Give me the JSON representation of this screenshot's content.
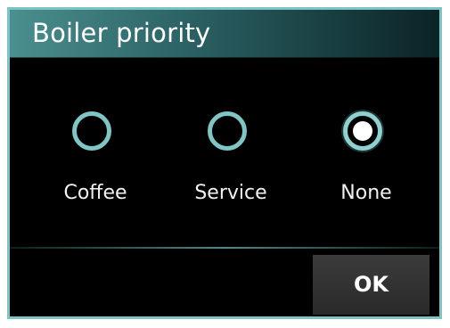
{
  "dialog": {
    "title": "Boiler priority"
  },
  "options": [
    {
      "label": "Coffee",
      "selected": false
    },
    {
      "label": "Service",
      "selected": false
    },
    {
      "label": "None",
      "selected": true
    }
  ],
  "footer": {
    "ok_label": "OK"
  },
  "colors": {
    "accent": "#7fc4c4",
    "background": "#000000",
    "title_gradient_start": "#4b8f8f",
    "title_gradient_end": "#0b2326",
    "text": "#ffffff"
  },
  "icons": {
    "radio_unselected": "radio-unselected-icon",
    "radio_selected": "radio-selected-icon"
  }
}
